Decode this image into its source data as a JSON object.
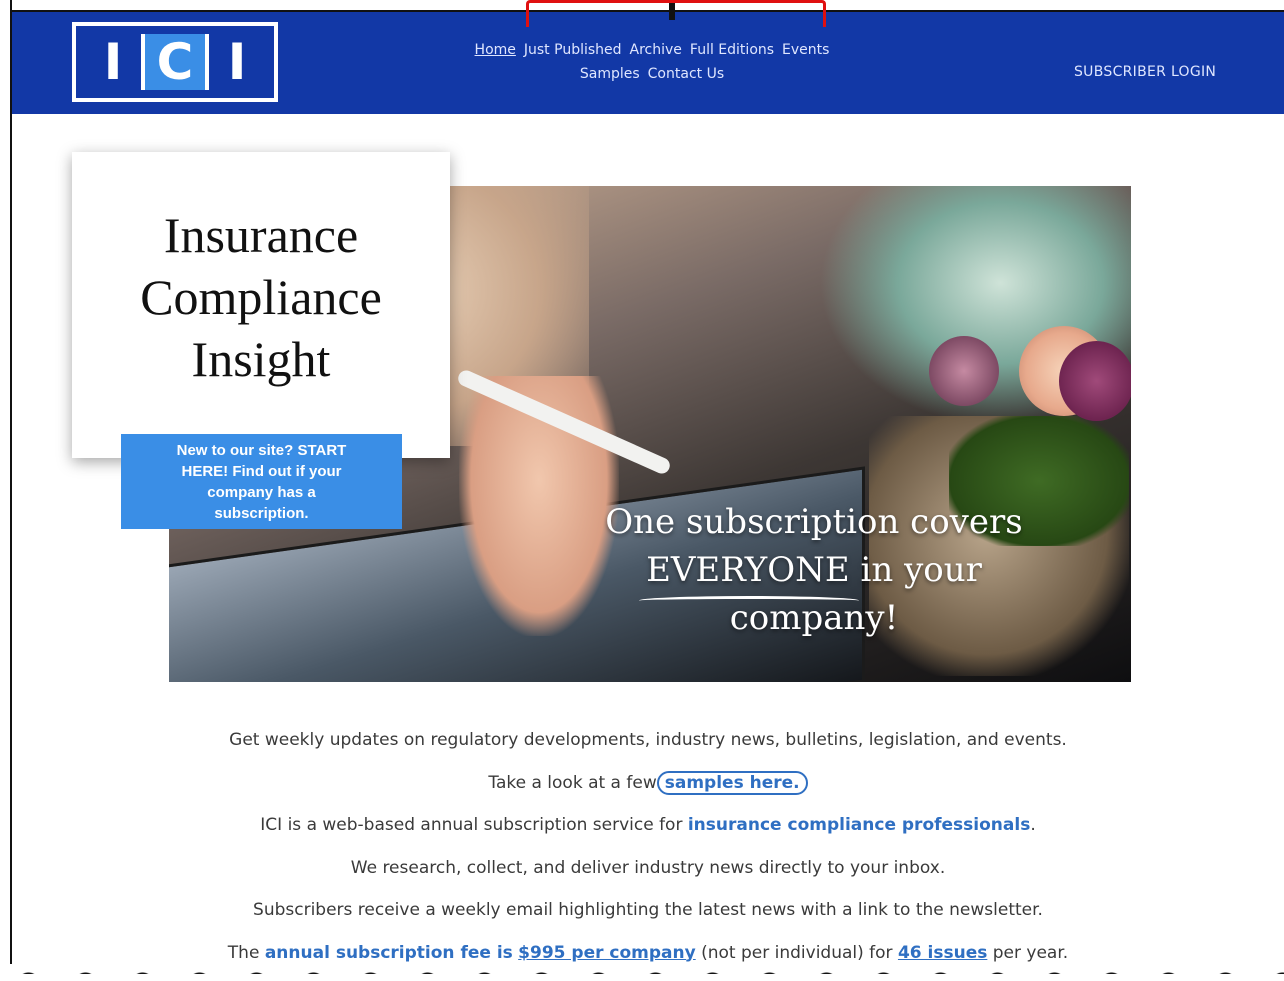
{
  "header": {
    "logo_text": "ICI",
    "nav": [
      "Home",
      "Just Published",
      "Archive",
      "Full Editions",
      "Events",
      "Samples",
      "Contact Us"
    ],
    "login": "SUBSCRIBER LOGIN",
    "bg_color": "#1238a6"
  },
  "hero": {
    "title_lines": [
      "Insurance",
      "Compliance",
      "Insight"
    ],
    "cta": "New to our site? START HERE! Find out if your company has a subscription.",
    "tagline_lines": [
      "One subscription covers",
      "EVERYONE in your",
      "company!"
    ]
  },
  "body": {
    "line1": "Get weekly updates on regulatory developments, industry news, bulletins, legislation, and events.",
    "line2_prefix": "Take a look at a few",
    "line2_link": "samples here.",
    "line3_prefix": "ICI is a web-based annual subscription service for",
    "line3_link": "insurance compliance professionals",
    "line3_suffix": ".",
    "line4": "We research, collect, and deliver industry news directly to your inbox.",
    "line5": "Subscribers receive a weekly email highlighting the latest news with a link to the newsletter.",
    "line6_prefix": "The",
    "line6_link1": "annual subscription fee is",
    "line6_link2": "$995 per company",
    "line6_mid": "(not per individual) for",
    "line6_link3": "46 issues",
    "line6_suffix": "per year."
  }
}
